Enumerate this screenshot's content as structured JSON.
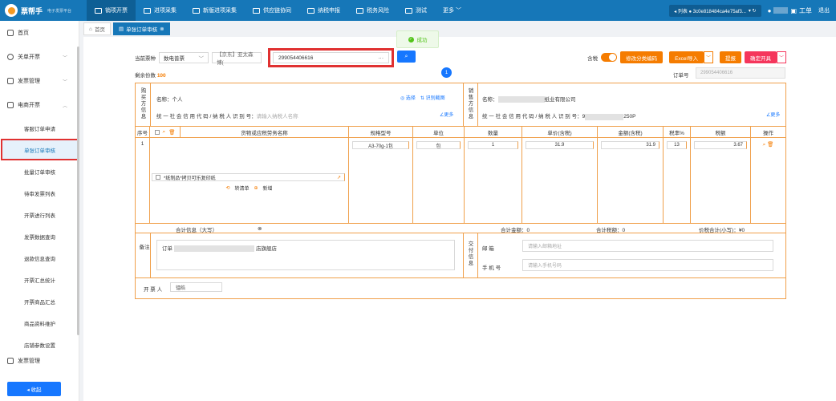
{
  "header": {
    "app_name": "票帮手",
    "app_sub": "电子发票平台",
    "nav": [
      {
        "label": "销项开票",
        "active": true
      },
      {
        "label": "进项采集",
        "active": false
      },
      {
        "label": "新版进项采集",
        "active": false
      },
      {
        "label": "供应链协同",
        "active": false
      },
      {
        "label": "纳税申报",
        "active": false
      },
      {
        "label": "税务风险",
        "active": false
      },
      {
        "label": "测试",
        "active": false
      },
      {
        "label": "更多 ﹀",
        "active": false
      }
    ],
    "company": "◂ 列表 ● 3c0e818484ca4e75af3...",
    "company_chevron": "▾ ↻",
    "user_label": "工单",
    "logout": "退出"
  },
  "sidebar": {
    "items": [
      {
        "label": "首页"
      },
      {
        "label": "关单开票",
        "chevron": "﹀"
      },
      {
        "label": "发票管理",
        "chevron": "﹀"
      },
      {
        "label": "电商开票",
        "chevron": "︿"
      }
    ],
    "sub_items": [
      {
        "label": "客服订单申请",
        "active": false
      },
      {
        "label": "单张订单审核",
        "active": true
      },
      {
        "label": "批量订单审核",
        "active": false
      },
      {
        "label": "待审发票列表",
        "active": false
      },
      {
        "label": "开票进行列表",
        "active": false
      },
      {
        "label": "发票数据查询",
        "active": false
      },
      {
        "label": "退款信息查询",
        "active": false
      },
      {
        "label": "开票汇总统计",
        "active": false
      },
      {
        "label": "开票商品汇总",
        "active": false
      },
      {
        "label": "商品资料维护",
        "active": false
      },
      {
        "label": "店铺参数设置",
        "active": false
      }
    ],
    "extra_item": "发票管理",
    "collapse": "◂ 收起"
  },
  "tabs": [
    {
      "label": "首页",
      "icon": "⌂"
    },
    {
      "label": "单张订单审核",
      "icon": "▤",
      "close": "⊗"
    }
  ],
  "toolbar": {
    "invoice_type_label": "当前票种",
    "invoice_type_value": "数电普票",
    "invoice_type_chevron": "﹀",
    "shop": "【京东】亚太森博(",
    "order_search": "299054406616",
    "search_more": "···",
    "search_btn": "⌕",
    "tax_included_label": "含税",
    "edit_code_btn": "修改分类编码",
    "excel_btn": "Excel导入",
    "excel_chevron": "﹀",
    "submit_btn": "提报",
    "confirm_btn": "确定开具",
    "confirm_chevron": "﹀"
  },
  "toast": {
    "icon": "✓",
    "text": "成功"
  },
  "remain": {
    "label": "剩余份数",
    "value": "100"
  },
  "badge": "1",
  "order": {
    "label": "订单号",
    "value": "299054406616"
  },
  "buyer": {
    "vlabel": "购买方信息",
    "name_label": "名称：",
    "name_value": "个人",
    "tax_label": "统 一 社 会 信 用 代 码 / 纳 税 人 识 别 号：",
    "tax_placeholder": "请输入纳税人名称",
    "choose": "◎ 选择",
    "ocr": "⇅ 识别截图",
    "more": "∠更多"
  },
  "seller": {
    "vlabel": "销售方信息",
    "name_label": "名称：",
    "name_suffix": "纸业有限公司",
    "tax_label": "统 一 社 会 信 用 代 码 / 纳 税 人 识 别 号：",
    "tax_prefix": "9",
    "tax_suffix": "250P",
    "more": "∠更多"
  },
  "goods_table": {
    "headers": [
      "序号",
      "货物或应税劳务名称",
      "规格型号",
      "单位",
      "数量",
      "单价(含税)",
      "金额(含税)",
      "税率%",
      "税额",
      "操作"
    ],
    "rows": [
      {
        "index": "1",
        "name": "*纸制品*拷贝可乐复印纸",
        "spec": "A3-70g-1包",
        "unit": "包",
        "qty": "1",
        "price": "31.9",
        "amount": "31.9",
        "rate": "13",
        "tax": "3.67"
      }
    ],
    "row_actions": "⌕ 🗑",
    "transfer": "转清单",
    "add": "新增"
  },
  "summary": {
    "cn_label": "合计信息（大写）",
    "cn_icon": "⊗",
    "amount": "合计金额：0",
    "tax": "合计税额：0",
    "total": "价税合计(小写)：¥0"
  },
  "remark": {
    "label": "备注",
    "text_prefix": "订单",
    "text_suffix": "店旗舰店"
  },
  "delivery": {
    "vlabel": "交付信息",
    "email_label": "邮 箱",
    "email_placeholder": "请输入邮箱地址",
    "phone_label": "手 机 号",
    "phone_placeholder": "请输入手机号码"
  },
  "drawer": {
    "label": "开 票 人",
    "value": "镭皓"
  }
}
